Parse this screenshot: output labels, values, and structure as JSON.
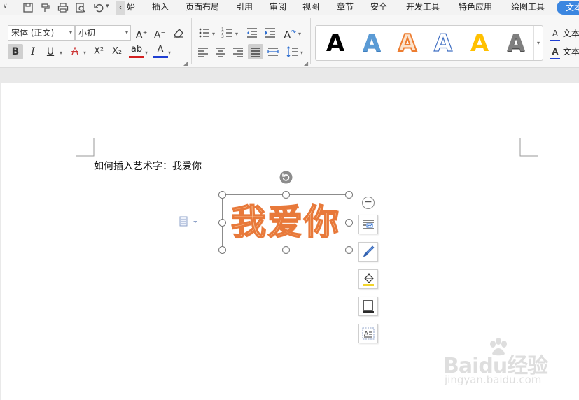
{
  "menubar": {
    "tabs": [
      {
        "id": "start",
        "label": "始"
      },
      {
        "id": "insert",
        "label": "插入"
      },
      {
        "id": "layout",
        "label": "页面布局"
      },
      {
        "id": "references",
        "label": "引用"
      },
      {
        "id": "review",
        "label": "审阅"
      },
      {
        "id": "view",
        "label": "视图"
      },
      {
        "id": "chapter",
        "label": "章节"
      },
      {
        "id": "security",
        "label": "安全"
      },
      {
        "id": "developer",
        "label": "开发工具"
      },
      {
        "id": "special",
        "label": "特色应用"
      },
      {
        "id": "drawing",
        "label": "绘图工具"
      }
    ],
    "active_tab": "文本",
    "scroll_left_glyph": "‹",
    "accent": "#3b86e0"
  },
  "ribbon": {
    "font_name": "宋体 (正文)",
    "font_size": "小初",
    "bold": "B",
    "italic": "I",
    "underline": "U",
    "superscript": "X²",
    "subscript": "X₂",
    "font_color_letter": "A",
    "highlight_letters": "ab",
    "wordart_styles": [
      {
        "letter": "A",
        "style": "black-solid"
      },
      {
        "letter": "A",
        "style": "blue-gradient"
      },
      {
        "letter": "A",
        "style": "orange-outline"
      },
      {
        "letter": "A",
        "style": "blue-outline"
      },
      {
        "letter": "A",
        "style": "yellow-solid"
      },
      {
        "letter": "A",
        "style": "gray-gradient"
      }
    ],
    "text_fill_label": "文本",
    "text_outline_label": "文本"
  },
  "document": {
    "line_text": "如何插入艺术字：我爱你",
    "wordart_text": "我爱你",
    "wordart_fill": "#fbd0a8",
    "wordart_stroke": "#e8793a"
  },
  "watermark": {
    "logo": "Baidu经验",
    "url": "jingyan.baidu.com"
  }
}
